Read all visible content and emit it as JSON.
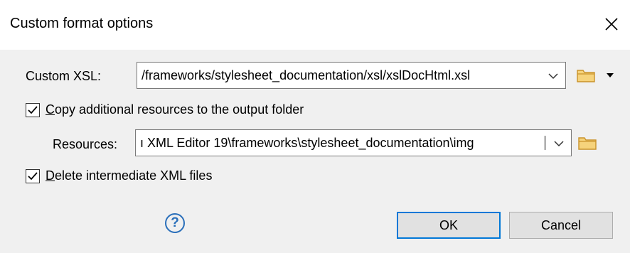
{
  "dialog": {
    "title": "Custom format options"
  },
  "custom_xsl": {
    "label": "Custom XSL:",
    "value": "/frameworks/stylesheet_documentation/xsl/xslDocHtml.xsl"
  },
  "copy_resources": {
    "checked": true,
    "mnemonic": "C",
    "label_rest": "opy additional resources to the output folder"
  },
  "resources": {
    "label": "Resources:",
    "value": "ı XML Editor 19\\frameworks\\stylesheet_documentation\\img"
  },
  "delete_intermediate": {
    "checked": true,
    "mnemonic": "D",
    "label_rest": "elete intermediate XML files"
  },
  "buttons": {
    "help": "?",
    "ok": "OK",
    "cancel": "Cancel"
  },
  "colors": {
    "folder": "#e8b33c",
    "focus_border": "#0078d7",
    "help": "#2a6fba"
  }
}
